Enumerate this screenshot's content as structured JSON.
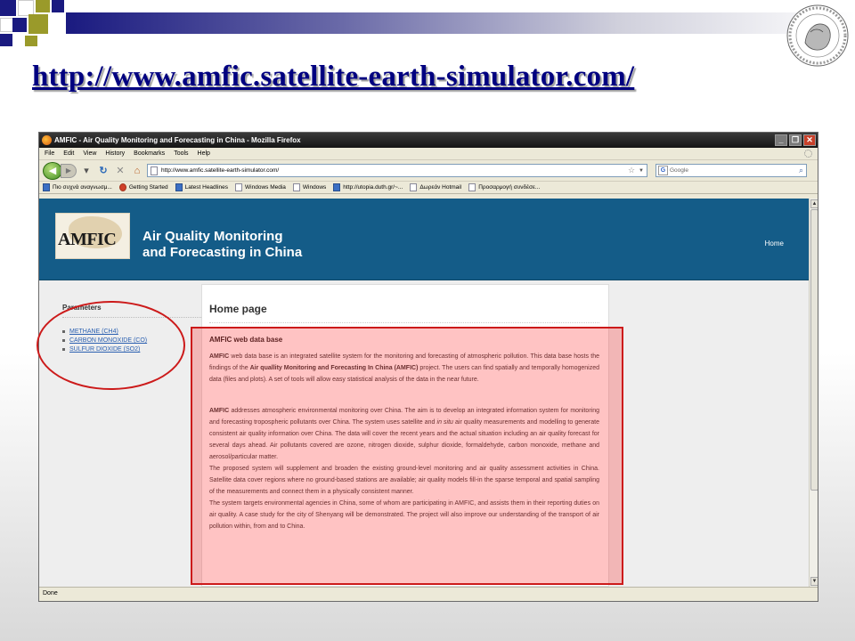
{
  "slide": {
    "url_title": "http://www.amfic.satellite-earth-simulator.com/",
    "logo_icon": "university-seal-icon",
    "colors": {
      "navy": "#000080",
      "gold": "#9a9a2a",
      "annotation_red": "#cc1a1a"
    }
  },
  "browser": {
    "window_title": "AMFIC - Air Quality Monitoring and Forecasting in China - Mozilla Firefox",
    "menu": [
      "File",
      "Edit",
      "View",
      "History",
      "Bookmarks",
      "Tools",
      "Help"
    ],
    "address": "http://www.amfic.satellite-earth-simulator.com/",
    "search_placeholder": "Google",
    "bookmarks": [
      "Πιο συχνά αναγνωσμ...",
      "Getting Started",
      "Latest Headlines",
      "Windows Media",
      "Windows",
      "http://utopia.duth.gr/~...",
      "Δωρεάν Hotmail",
      "Προσαρμογή συνδέσε..."
    ],
    "status": "Done"
  },
  "site": {
    "logo_text": "AMFIC",
    "title_line1": "Air Quality Monitoring",
    "title_line2": "and Forecasting in China",
    "nav_home": "Home",
    "colors": {
      "header": "#145c88"
    }
  },
  "sidebar": {
    "heading": "Parameters",
    "links": [
      "METHANE (CH4)",
      "CARBON MONOXIDE (CO)",
      "SULFUR DIOXIDE (SO2)"
    ]
  },
  "content": {
    "page_title": "Home page",
    "section_title": "AMFIC web data base",
    "p1_b1": "AMFIC",
    "p1_t1": " web data base is an integrated satellite system for the monitoring and forecasting of atmospheric pollution. This data base hosts the findings of the ",
    "p1_b2": "Air quallity Monitoring and Forecasting In China (AMFIC)",
    "p1_t2": " project. The users can find spatially and temporally homogenized data (files and plots). A set of tools will allow easy statistical analysis of the data in the near future.",
    "p2_b1": "AMFIC",
    "p2_t1": " addresses atmospheric environmental monitoring over China. The aim is to develop an integrated information system for monitoring and forecasting tropospheric pollutants over China. The system uses satellite and ",
    "p2_i1": "in situ",
    "p2_t2": " air quality measurements and modelling to generate consistent air quality information over China. The data will cover the recent years and the actual situation including an air quality forecast for several days ahead. Air pollutants covered are ozone, nitrogen dioxide, sulphur dioxide, formaldehyde, carbon monoxide, methane and aerosol/particular matter.",
    "p3": "The proposed system will supplement and broaden the existing ground-level monitoring and air quality assessment activities in China. Satellite data cover regions where no ground-based stations are available; air quality models fill-in the sparse temporal and spatial sampling of the measurements and connect them in a physically consistent manner.",
    "p4": "The system targets environmental agencies in China, some of whom are participating in AMFIC, and assists them in their reporting duties on air quality. A case study for the city of Shenyang will be demonstrated. The project will also improve our understanding of the transport of air pollution within, from and to China."
  }
}
